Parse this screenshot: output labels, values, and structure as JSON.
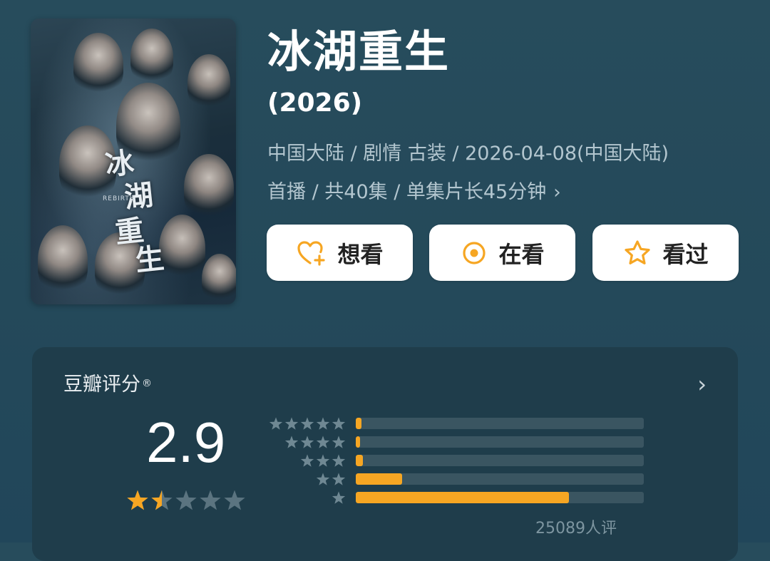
{
  "poster": {
    "title_art_chars": [
      "冰",
      "湖",
      "重",
      "生"
    ],
    "subtitle": "REBIRTH"
  },
  "title": "冰湖重生",
  "year": "(2026)",
  "meta": {
    "line1": "中国大陆 / 剧情 古装 / 2026-04-08(中国大陆)",
    "line2": "首播 / 共40集 / 单集片长45分钟"
  },
  "actions": {
    "want": "想看",
    "watching": "在看",
    "watched": "看过"
  },
  "rating": {
    "title": "豆瓣评分",
    "registered_mark": "®",
    "score": "2.9",
    "score_stars": 1.5,
    "count_text": "25089人评",
    "distribution": [
      {
        "stars": 5,
        "percent": 2
      },
      {
        "stars": 4,
        "percent": 1.5
      },
      {
        "stars": 3,
        "percent": 2.5
      },
      {
        "stars": 2,
        "percent": 16
      },
      {
        "stars": 1,
        "percent": 74
      }
    ]
  },
  "colors": {
    "background": "#274c5c",
    "card": "#1f3d4b",
    "accent": "#f6a623",
    "bar_track": "#3a5561",
    "muted_text": "#b3c6cf"
  }
}
